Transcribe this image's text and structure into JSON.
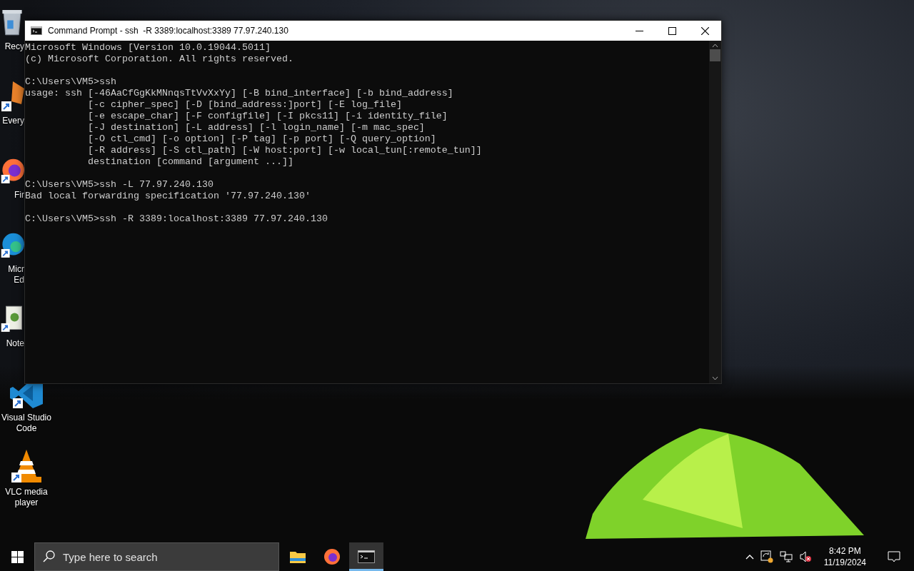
{
  "desktop_icons": [
    {
      "kind": "recycle",
      "label_lines": [
        "Recy"
      ],
      "partial": true
    },
    {
      "kind": "generic",
      "label_lines": [
        "Every"
      ],
      "partial": true
    },
    {
      "kind": "firefox",
      "label_lines": [
        "Fir"
      ],
      "partial": true
    },
    {
      "kind": "edge",
      "label_lines": [
        "Micr",
        "Ed"
      ],
      "partial": true
    },
    {
      "kind": "notepad",
      "label_lines": [
        "Note"
      ],
      "partial": true
    },
    {
      "kind": "vscode",
      "label_lines": [
        "Visual Studio",
        "Code"
      ],
      "partial": false
    },
    {
      "kind": "vlc",
      "label_lines": [
        "VLC media",
        "player"
      ],
      "partial": false
    }
  ],
  "window": {
    "title": "Command Prompt - ssh  -R 3389:localhost:3389 77.97.240.130",
    "blocks": [
      [
        "Microsoft Windows [Version 10.0.19044.5011]",
        "(c) Microsoft Corporation. All rights reserved."
      ],
      [
        "C:\\Users\\VM5>ssh",
        "usage: ssh [-46AaCfGgKkMNnqsTtVvXxYy] [-B bind_interface] [-b bind_address]",
        "           [-c cipher_spec] [-D [bind_address:]port] [-E log_file]",
        "           [-e escape_char] [-F configfile] [-I pkcs11] [-i identity_file]",
        "           [-J destination] [-L address] [-l login_name] [-m mac_spec]",
        "           [-O ctl_cmd] [-o option] [-P tag] [-p port] [-Q query_option]",
        "           [-R address] [-S ctl_path] [-W host:port] [-w local_tun[:remote_tun]]",
        "           destination [command [argument ...]]"
      ],
      [
        "C:\\Users\\VM5>ssh -L 77.97.240.130",
        "Bad local forwarding specification '77.97.240.130'"
      ],
      [
        "C:\\Users\\VM5>ssh -R 3389:localhost:3389 77.97.240.130"
      ]
    ]
  },
  "taskbar": {
    "search": {
      "placeholder": "Type here to search"
    },
    "apps": [
      {
        "kind": "explorer",
        "running": false
      },
      {
        "kind": "firefox",
        "running": false
      },
      {
        "kind": "cmd",
        "running": true
      }
    ],
    "time": "8:42 PM",
    "date": "11/19/2024"
  }
}
